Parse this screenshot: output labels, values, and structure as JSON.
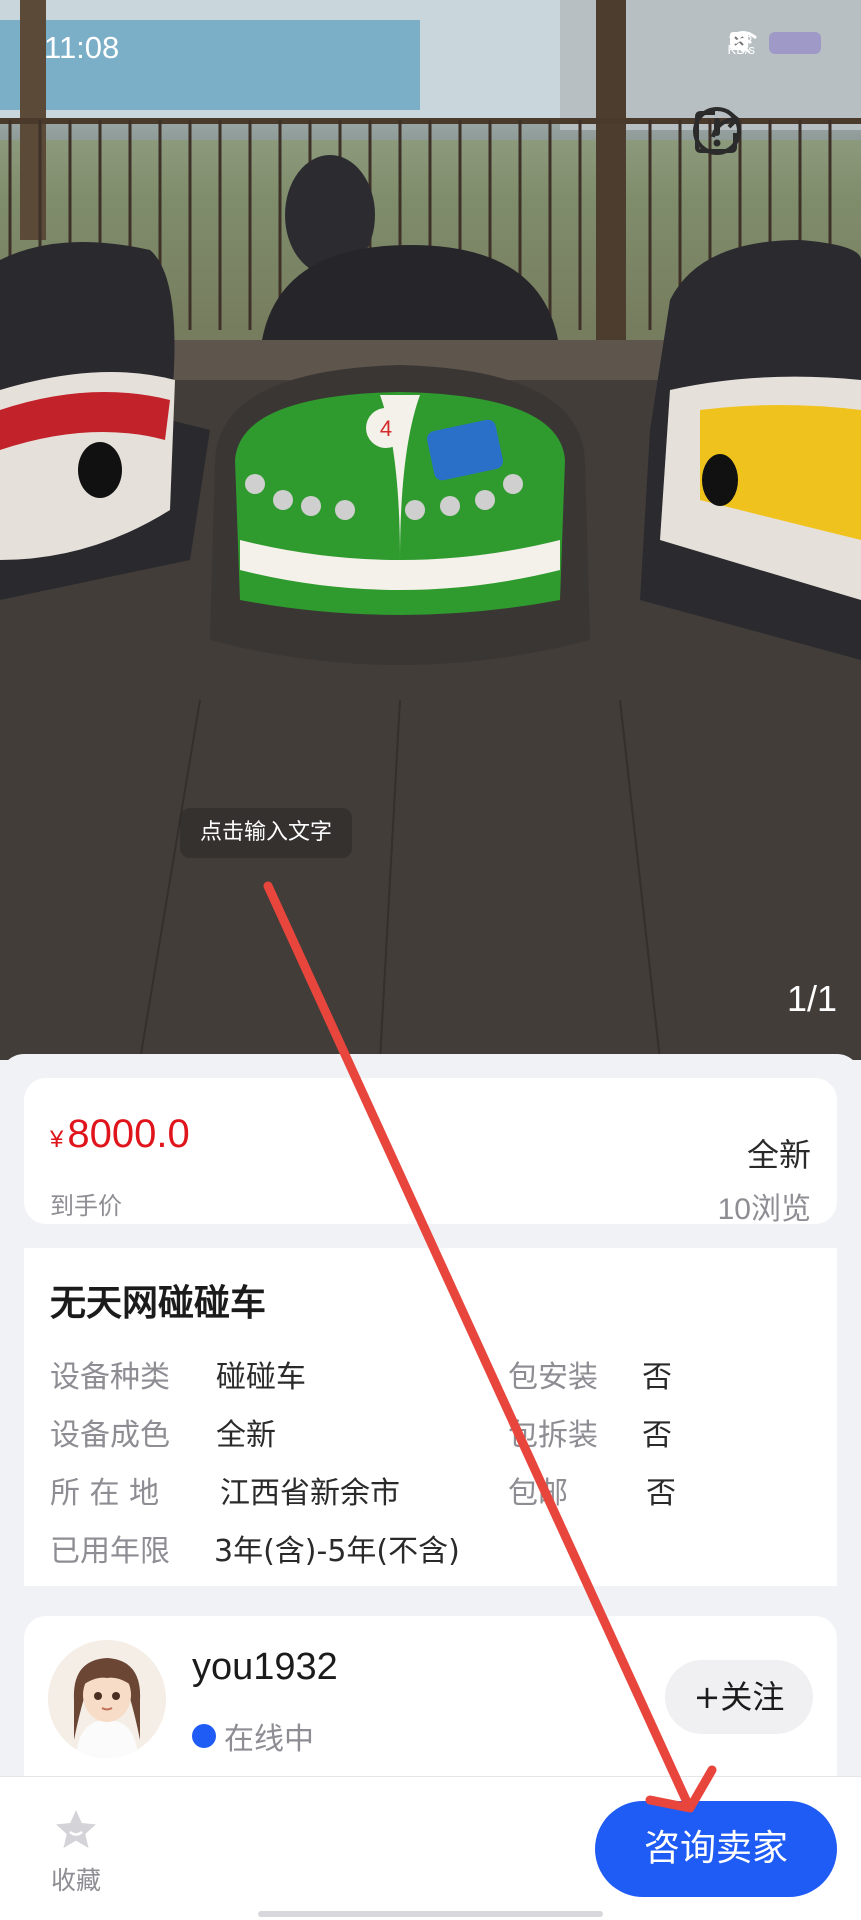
{
  "status_bar": {
    "time": "11:08",
    "net_speed": "183",
    "net_unit": "KB/s"
  },
  "gallery": {
    "ocr_tip": "点击输入文字",
    "counter": "1/1",
    "bumper_car_number": "4"
  },
  "price_card": {
    "currency": "¥",
    "price": "8000.0",
    "price_label": "到手价",
    "condition": "全新",
    "views": "10浏览"
  },
  "detail": {
    "title": "无天网碰碰车",
    "rows": [
      {
        "label": "设备种类",
        "value": "碰碰车"
      },
      {
        "label": "设备成色",
        "value": "全新"
      },
      {
        "label": "所 在 地",
        "value": "江西省新余市"
      },
      {
        "label": "已用年限",
        "value": "3年(含)-5年(不含)"
      }
    ],
    "options": [
      {
        "label": "包安装",
        "value": "否"
      },
      {
        "label": "包拆装",
        "value": "否"
      },
      {
        "label": "包邮",
        "value": "否"
      }
    ]
  },
  "seller": {
    "name": "you1932",
    "status": "在线中",
    "follow_label": "+关注"
  },
  "bottom_bar": {
    "favorite_label": "收藏",
    "consult_label": "咨询卖家"
  },
  "colors": {
    "price_red": "#e0141b",
    "accent_blue": "#1f5cf5",
    "annotation_red": "#e8453c"
  }
}
